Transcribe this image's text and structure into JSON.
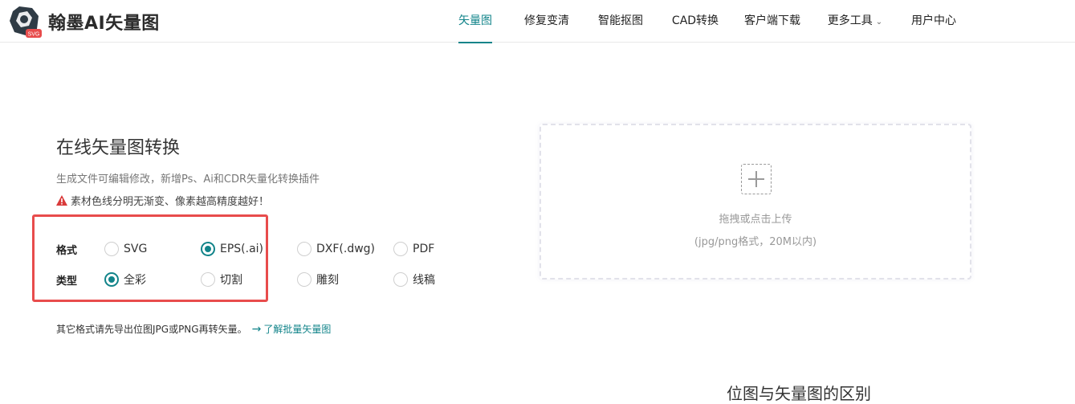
{
  "header": {
    "logo_text": "翰墨AI矢量图",
    "logo_badge": "SVG",
    "nav": [
      {
        "label": "矢量图",
        "active": true
      },
      {
        "label": "修复变清",
        "active": false
      },
      {
        "label": "智能抠图",
        "active": false
      },
      {
        "label": "CAD转换",
        "active": false
      },
      {
        "label": "客户端下载",
        "active": false
      },
      {
        "label": "更多工具",
        "active": false,
        "dropdown": true
      },
      {
        "label": "用户中心",
        "active": false
      }
    ]
  },
  "main": {
    "title": "在线矢量图转换",
    "subtitle": "生成文件可编辑修改，新增Ps、Ai和CDR矢量化转换插件",
    "warning": "素材色线分明无渐变、像素越高精度越好！",
    "format": {
      "label": "格式",
      "options": [
        "SVG",
        "EPS(.ai)",
        "DXF(.dwg)",
        "PDF"
      ],
      "selected": "EPS(.ai)"
    },
    "type": {
      "label": "类型",
      "options": [
        "全彩",
        "切割",
        "雕刻",
        "线稿"
      ],
      "selected": "全彩"
    },
    "note": "其它格式请先导出位图JPG或PNG再转矢量。",
    "note_link": "了解批量矢量图"
  },
  "upload": {
    "text": "拖拽或点击上传",
    "hint": "(jpg/png格式，20M以内)"
  },
  "bottom_heading_partial": "位图与矢量图的区别",
  "colors": {
    "accent": "#12848a",
    "highlight_border": "#e84c4c",
    "warning": "#d93a3a"
  }
}
